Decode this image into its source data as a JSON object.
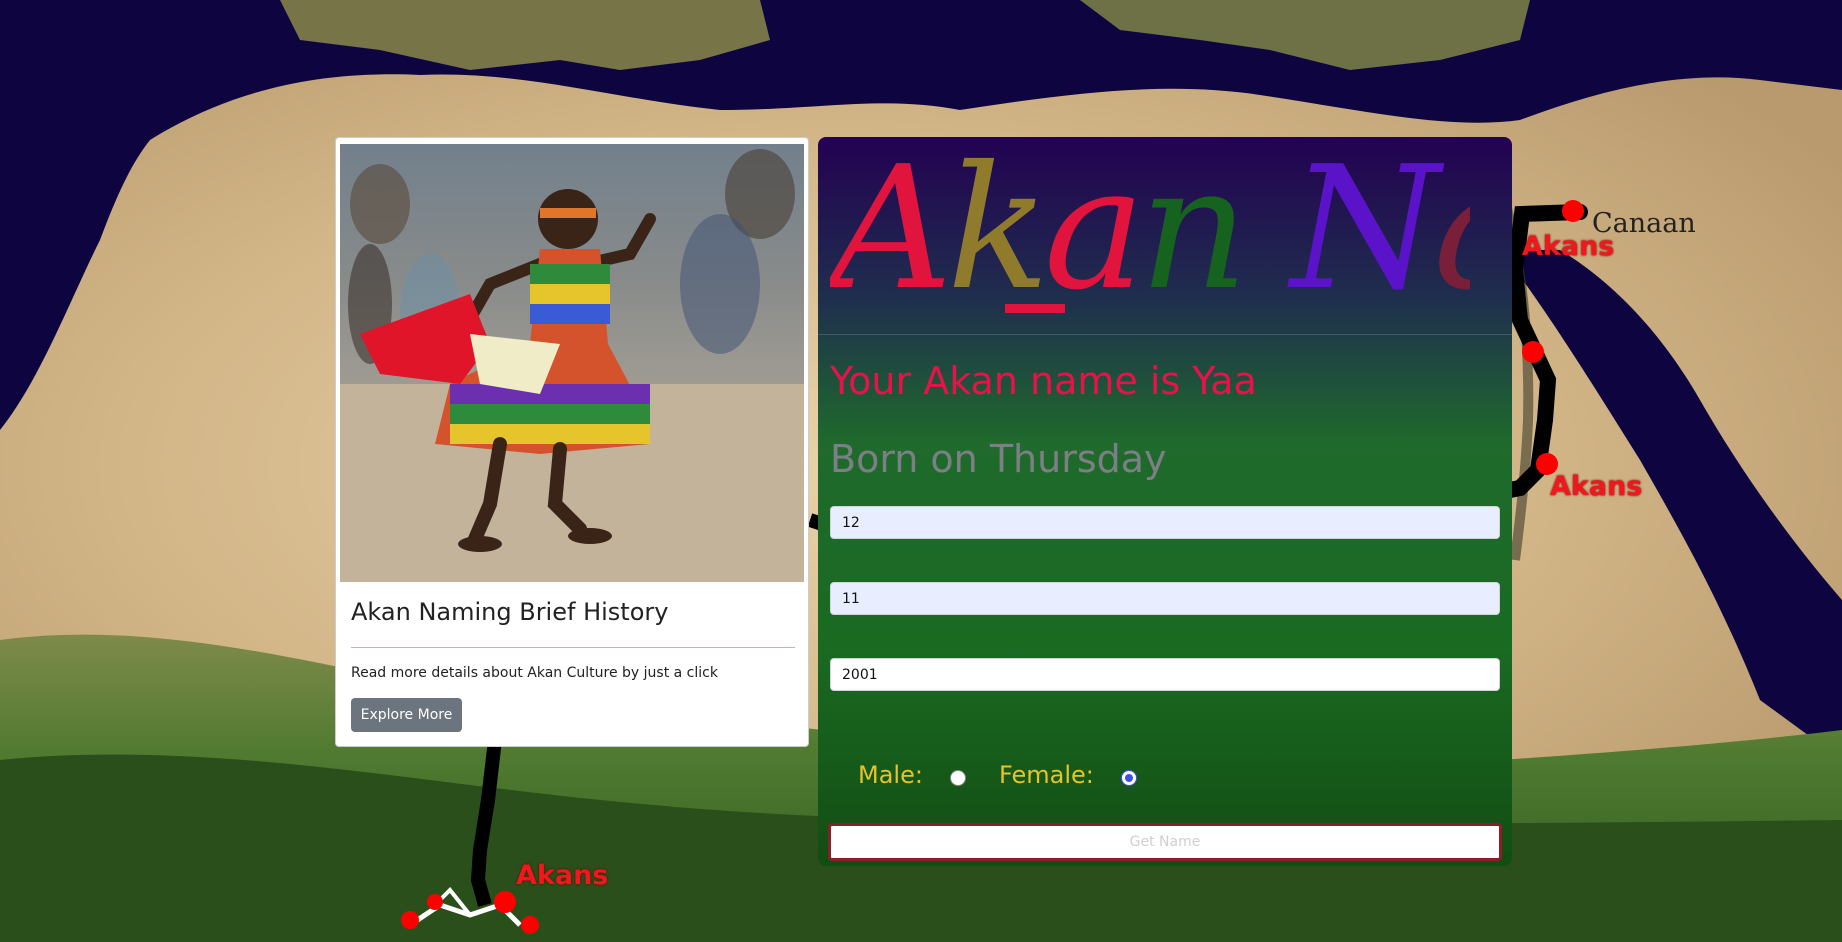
{
  "map": {
    "labels": {
      "canaan": "Canaan",
      "akans_north": "Akans",
      "akans_east": "Akans",
      "akans_west": "Akans"
    },
    "colors": {
      "sea": "#0e0540",
      "desert": "#d9c39a",
      "vegetation": "#3e6e28",
      "route": "#000000",
      "marker": "#ff0000"
    }
  },
  "card": {
    "image_alt": "Child dancing in kente cloth",
    "title": "Akan Naming Brief History",
    "text": "Read more details about Akan Culture by just a click",
    "button_label": "Explore More"
  },
  "form": {
    "logo": {
      "text": "Akan Names",
      "letter_colors": [
        "#e0143c",
        "#8f7b2b",
        "#e0143c",
        "#16621f",
        "#5a13c8",
        "#7a1f3a",
        "#3a0a3a",
        "#2f0a2a",
        "#c61a3a",
        "#c8a52a"
      ]
    },
    "result": "Your Akan name is Yaa",
    "born": "Born on Thursday",
    "day_value": "12",
    "month_value": "11",
    "year_value": "2001",
    "male_label": "Male:",
    "female_label": "Female:",
    "selected_gender": "female",
    "submit_label": "Get Name"
  }
}
